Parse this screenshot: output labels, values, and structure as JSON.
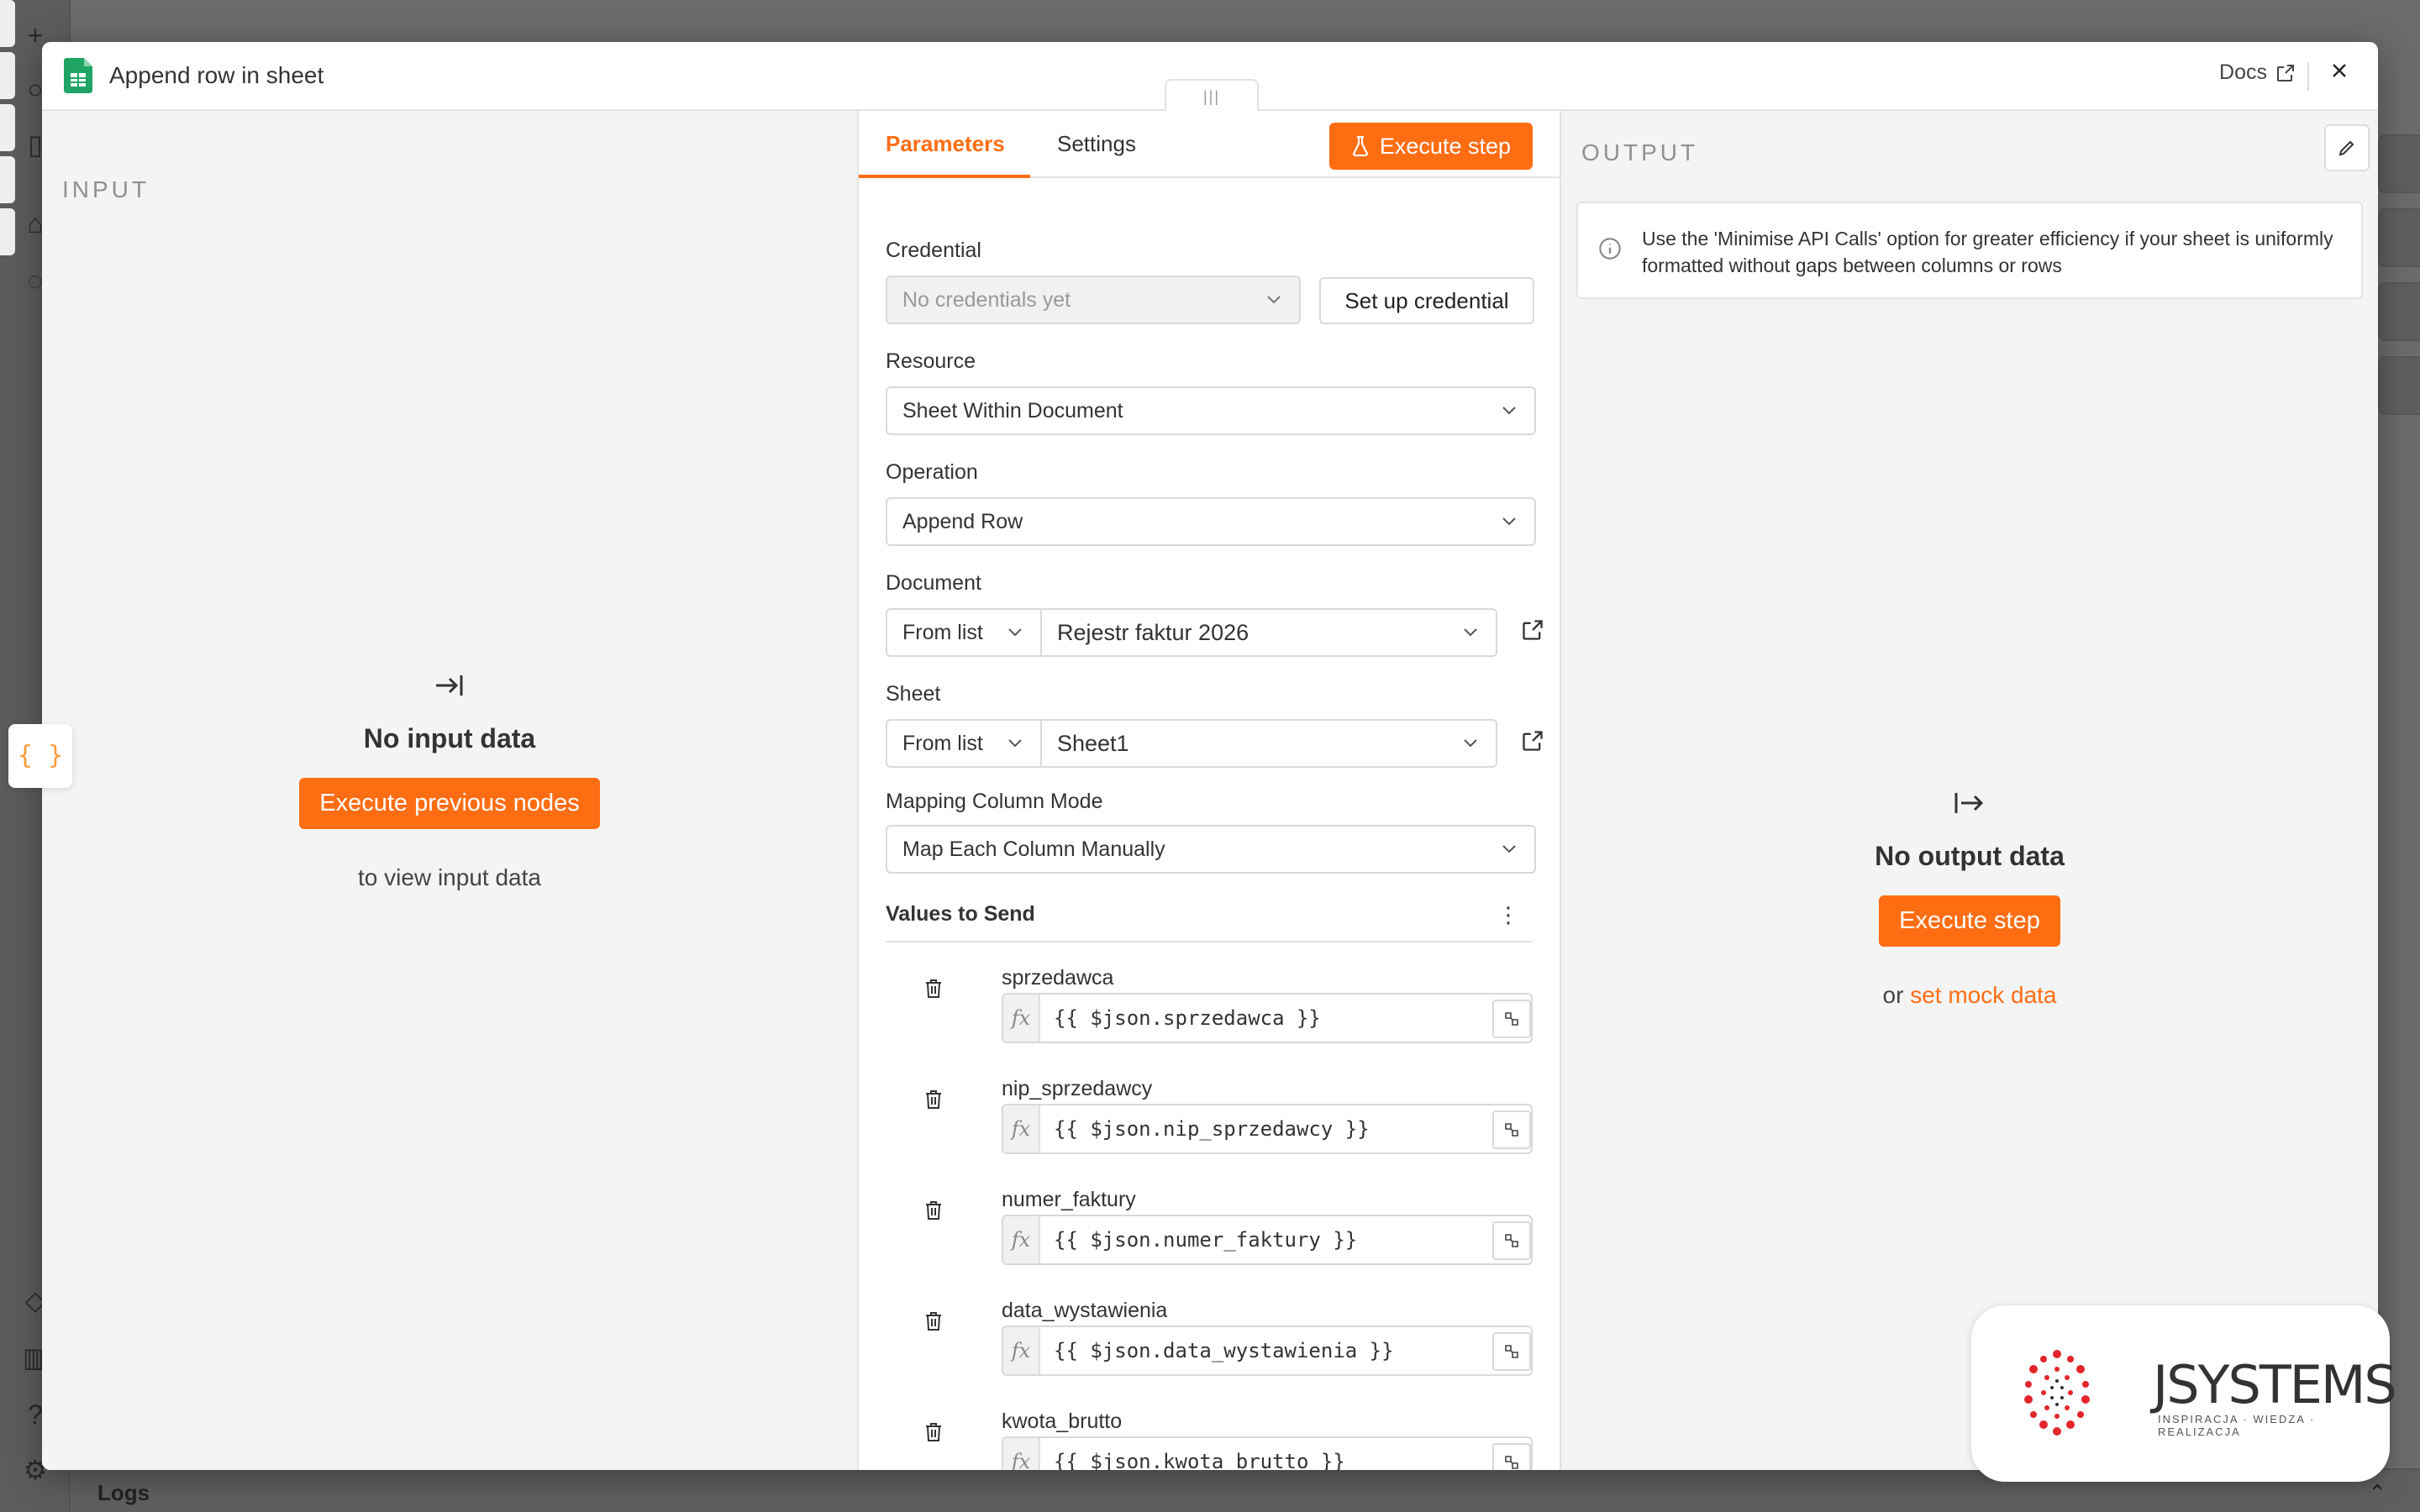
{
  "background": {
    "logs_label": "Logs"
  },
  "modal": {
    "title": "Append row in sheet",
    "docs_label": "Docs",
    "close_icon": "close-icon"
  },
  "input": {
    "label": "INPUT",
    "empty_title": "No input data",
    "execute_previous_label": "Execute previous nodes",
    "hint": "to view input data"
  },
  "tabs": {
    "parameters": "Parameters",
    "settings": "Settings",
    "execute_step": "Execute step"
  },
  "form": {
    "credential_label": "Credential",
    "credential_placeholder": "No credentials yet",
    "setup_credential": "Set up credential",
    "resource_label": "Resource",
    "resource_value": "Sheet Within Document",
    "operation_label": "Operation",
    "operation_value": "Append Row",
    "document_label": "Document",
    "document_mode": "From list",
    "document_value": "Rejestr faktur 2026",
    "sheet_label": "Sheet",
    "sheet_mode": "From list",
    "sheet_value": "Sheet1",
    "mapping_label": "Mapping Column Mode",
    "mapping_value": "Map Each Column Manually",
    "values_header": "Values to Send",
    "values": [
      {
        "label": "sprzedawca",
        "expr": "{{ $json.sprzedawca }}"
      },
      {
        "label": "nip_sprzedawcy",
        "expr": "{{ $json.nip_sprzedawcy }}"
      },
      {
        "label": "numer_faktury",
        "expr": "{{ $json.numer_faktury }}"
      },
      {
        "label": "data_wystawienia",
        "expr": "{{ $json.data_wystawienia }}"
      },
      {
        "label": "kwota_brutto",
        "expr": "{{ $json.kwota_brutto }}"
      }
    ]
  },
  "output": {
    "label": "OUTPUT",
    "callout": "Use the 'Minimise API Calls' option for greater efficiency if your sheet is uniformly formatted without gaps between columns or rows",
    "empty_title": "No output data",
    "execute_step": "Execute step",
    "or_text": "or",
    "mock_link": "set mock data"
  },
  "watermark": {
    "brand": "JSYSTEMS",
    "tagline": "INSPIRACJA · WIEDZA · REALIZACJA"
  },
  "colors": {
    "accent": "#ff6d13",
    "sheets_green": "#1fa463"
  }
}
